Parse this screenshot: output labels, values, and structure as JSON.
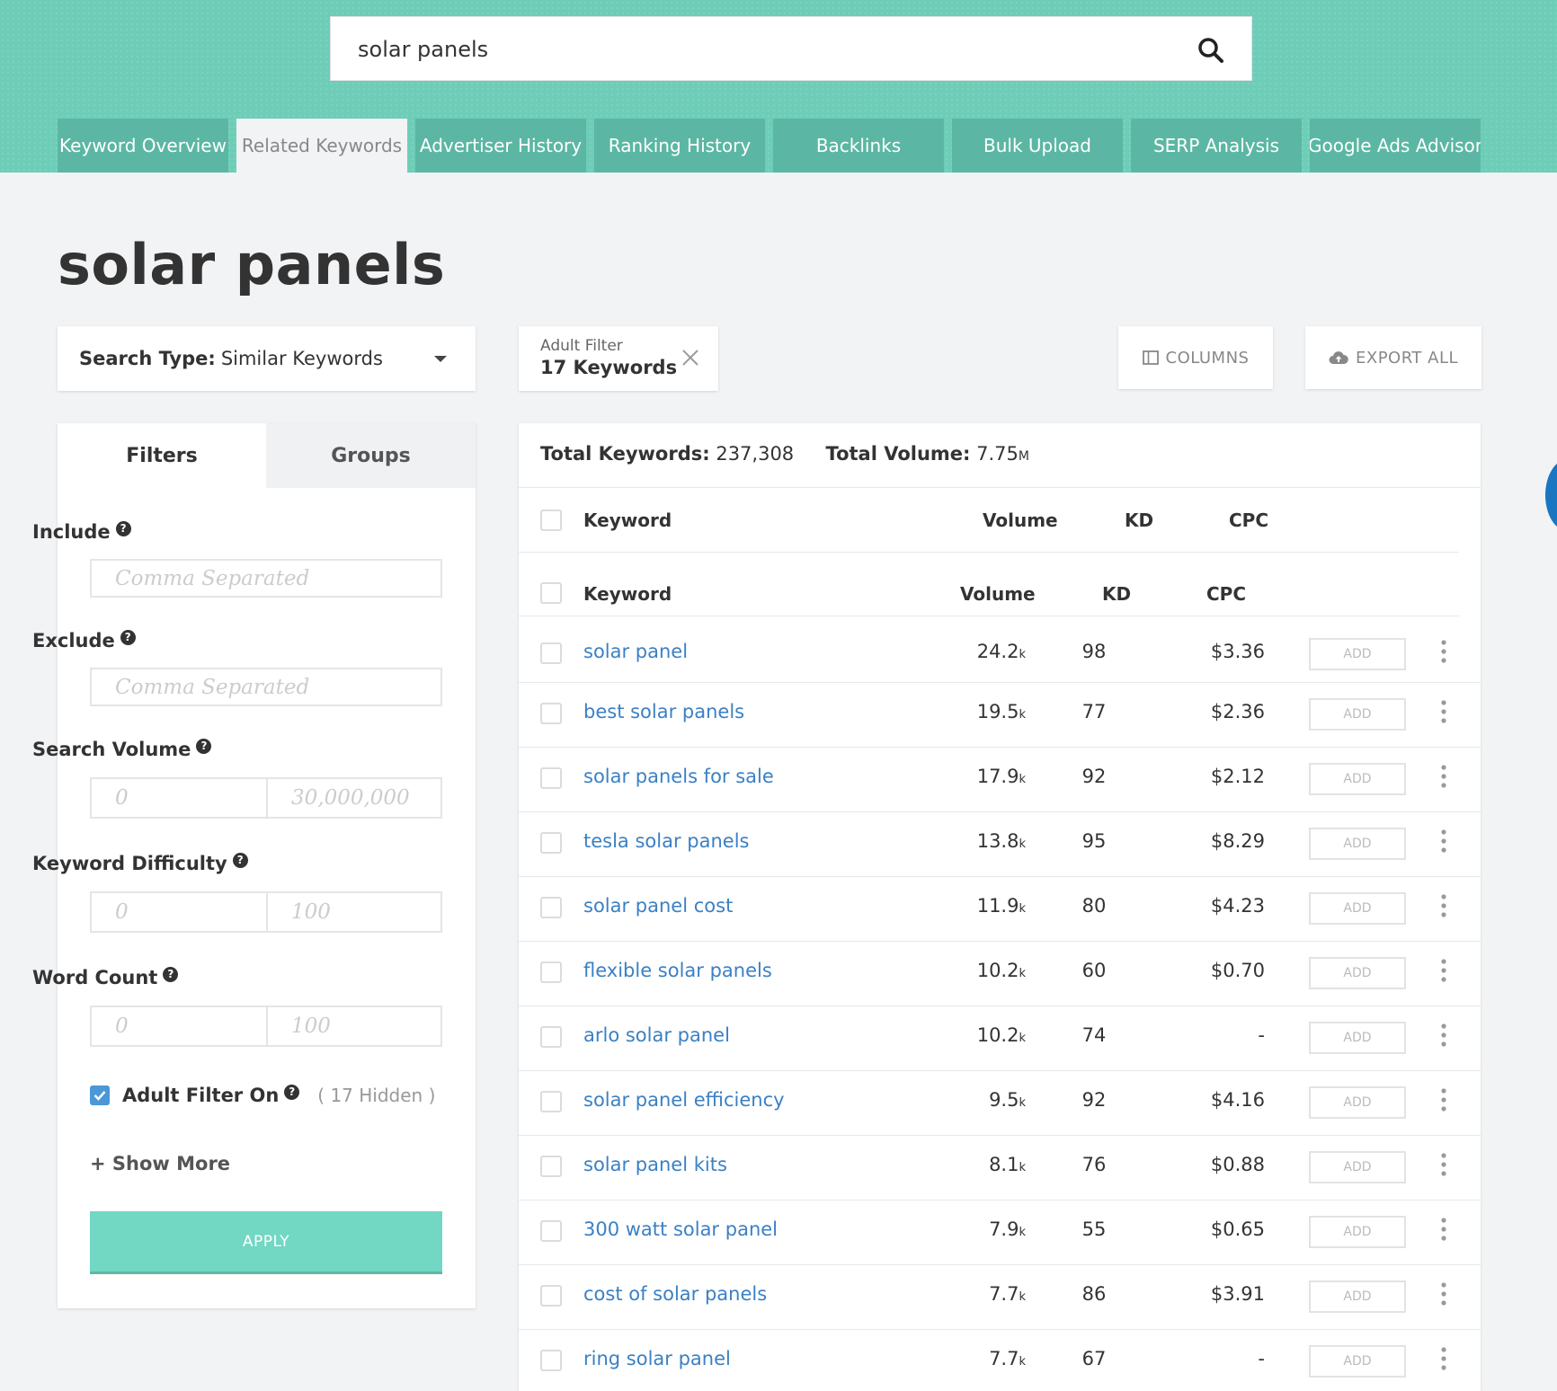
{
  "search": {
    "query": "solar panels"
  },
  "tabs": [
    "Keyword Overview",
    "Related Keywords",
    "Advertiser History",
    "Ranking History",
    "Backlinks",
    "Bulk Upload",
    "SERP Analysis",
    "Google Ads Advisor"
  ],
  "active_tab": "Related Keywords",
  "page_title": "solar panels",
  "search_type": {
    "label": "Search Type:",
    "value": "Similar Keywords"
  },
  "adult_filter_chip": {
    "line1": "Adult Filter",
    "line2": "17 Keywords"
  },
  "buttons": {
    "columns": "COLUMNS",
    "export_all": "EXPORT ALL",
    "apply": "APPLY",
    "show_more": "+ Show More",
    "add": "ADD"
  },
  "filters": {
    "tabs": {
      "filters": "Filters",
      "groups": "Groups"
    },
    "include": {
      "label": "Include",
      "placeholder": "Comma Separated"
    },
    "exclude": {
      "label": "Exclude",
      "placeholder": "Comma Separated"
    },
    "search_volume": {
      "label": "Search Volume",
      "min": "0",
      "max": "30,000,000"
    },
    "keyword_difficulty": {
      "label": "Keyword Difficulty",
      "min": "0",
      "max": "100"
    },
    "word_count": {
      "label": "Word Count",
      "min": "0",
      "max": "100"
    },
    "adult_filter": {
      "label": "Adult Filter On",
      "checked": true,
      "hidden": "( 17 Hidden )"
    }
  },
  "totals": {
    "keywords_label": "Total Keywords:",
    "keywords_value": "237,308",
    "volume_label": "Total Volume:",
    "volume_value": "7.75",
    "volume_unit": "M"
  },
  "table": {
    "columns": [
      "Keyword",
      "Volume",
      "KD",
      "CPC"
    ],
    "rows": [
      {
        "keyword": "solar panel",
        "volume": "24.2",
        "unit": "k",
        "kd": "98",
        "cpc": "$3.36"
      },
      {
        "keyword": "best solar panels",
        "volume": "19.5",
        "unit": "k",
        "kd": "77",
        "cpc": "$2.36"
      },
      {
        "keyword": "solar panels for sale",
        "volume": "17.9",
        "unit": "k",
        "kd": "92",
        "cpc": "$2.12"
      },
      {
        "keyword": "tesla solar panels",
        "volume": "13.8",
        "unit": "k",
        "kd": "95",
        "cpc": "$8.29"
      },
      {
        "keyword": "solar panel cost",
        "volume": "11.9",
        "unit": "k",
        "kd": "80",
        "cpc": "$4.23"
      },
      {
        "keyword": "flexible solar panels",
        "volume": "10.2",
        "unit": "k",
        "kd": "60",
        "cpc": "$0.70"
      },
      {
        "keyword": "arlo solar panel",
        "volume": "10.2",
        "unit": "k",
        "kd": "74",
        "cpc": "-"
      },
      {
        "keyword": "solar panel efficiency",
        "volume": "9.5",
        "unit": "k",
        "kd": "92",
        "cpc": "$4.16"
      },
      {
        "keyword": "solar panel kits",
        "volume": "8.1",
        "unit": "k",
        "kd": "76",
        "cpc": "$0.88"
      },
      {
        "keyword": "300 watt solar panel",
        "volume": "7.9",
        "unit": "k",
        "kd": "55",
        "cpc": "$0.65"
      },
      {
        "keyword": "cost of solar panels",
        "volume": "7.7",
        "unit": "k",
        "kd": "86",
        "cpc": "$3.91"
      },
      {
        "keyword": "ring solar panel",
        "volume": "7.7",
        "unit": "k",
        "kd": "67",
        "cpc": "-"
      }
    ]
  },
  "colors": {
    "header_bg": "#6dcdb7",
    "tab_bg": "#5bb7a3",
    "link": "#3b80c4",
    "apply": "#72d7c3",
    "checkbox": "#4b97d8"
  },
  "icons": {
    "search": "search-icon",
    "close": "close-icon",
    "columns": "columns-icon",
    "export": "cloud-upload-icon",
    "help": "help-circle-icon",
    "more": "more-vertical-icon",
    "dropdown": "caret-down-icon"
  }
}
